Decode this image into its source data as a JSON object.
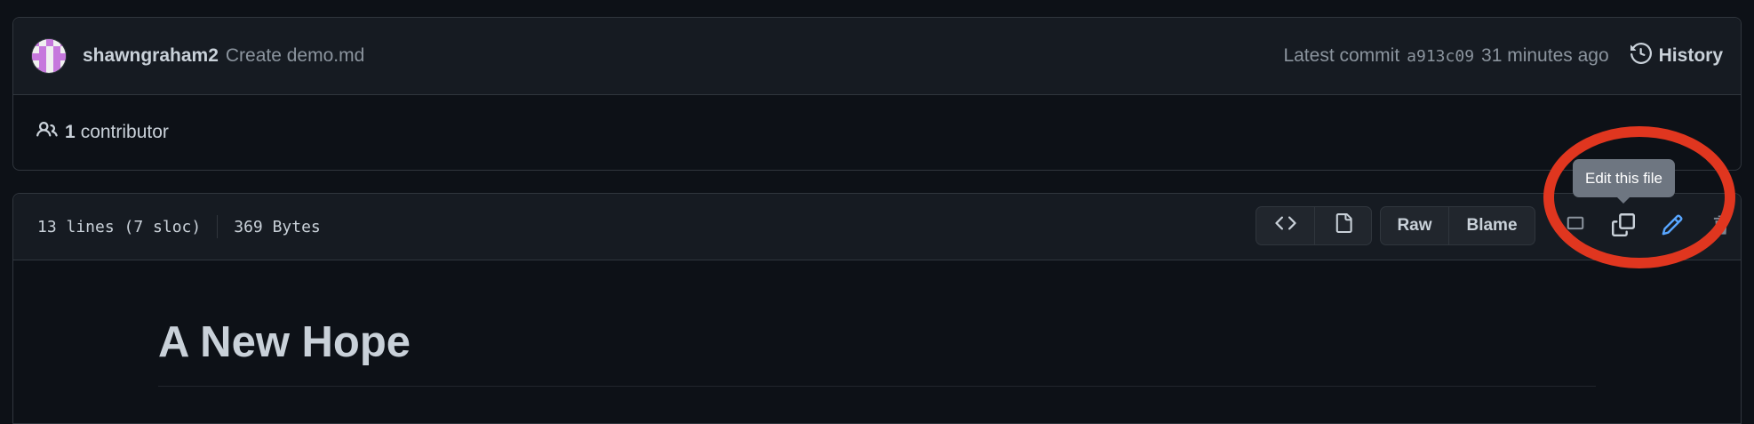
{
  "commit": {
    "author": "shawngraham2",
    "message": "Create demo.md",
    "latest_label": "Latest commit",
    "sha": "a913c09",
    "time_ago": "31 minutes ago",
    "history_label": "History"
  },
  "contributors": {
    "count": "1",
    "label": "contributor"
  },
  "file": {
    "lines": "13 lines (7 sloc)",
    "size": "369 Bytes",
    "toolbar": {
      "code_icon": "code-icon",
      "preview_icon": "file-icon",
      "raw_label": "Raw",
      "blame_label": "Blame",
      "copy_icon": "copy-icon",
      "edit_icon": "pencil-icon",
      "delete_icon": "trash-icon"
    },
    "tooltip": "Edit this file"
  },
  "content": {
    "heading": "A New Hope"
  },
  "colors": {
    "background": "#0d1117",
    "panel": "#161b22",
    "border": "#30363d",
    "edit_icon": "#58a6ff",
    "annotation": "#e0361f",
    "tooltip_bg": "#6e7681"
  }
}
